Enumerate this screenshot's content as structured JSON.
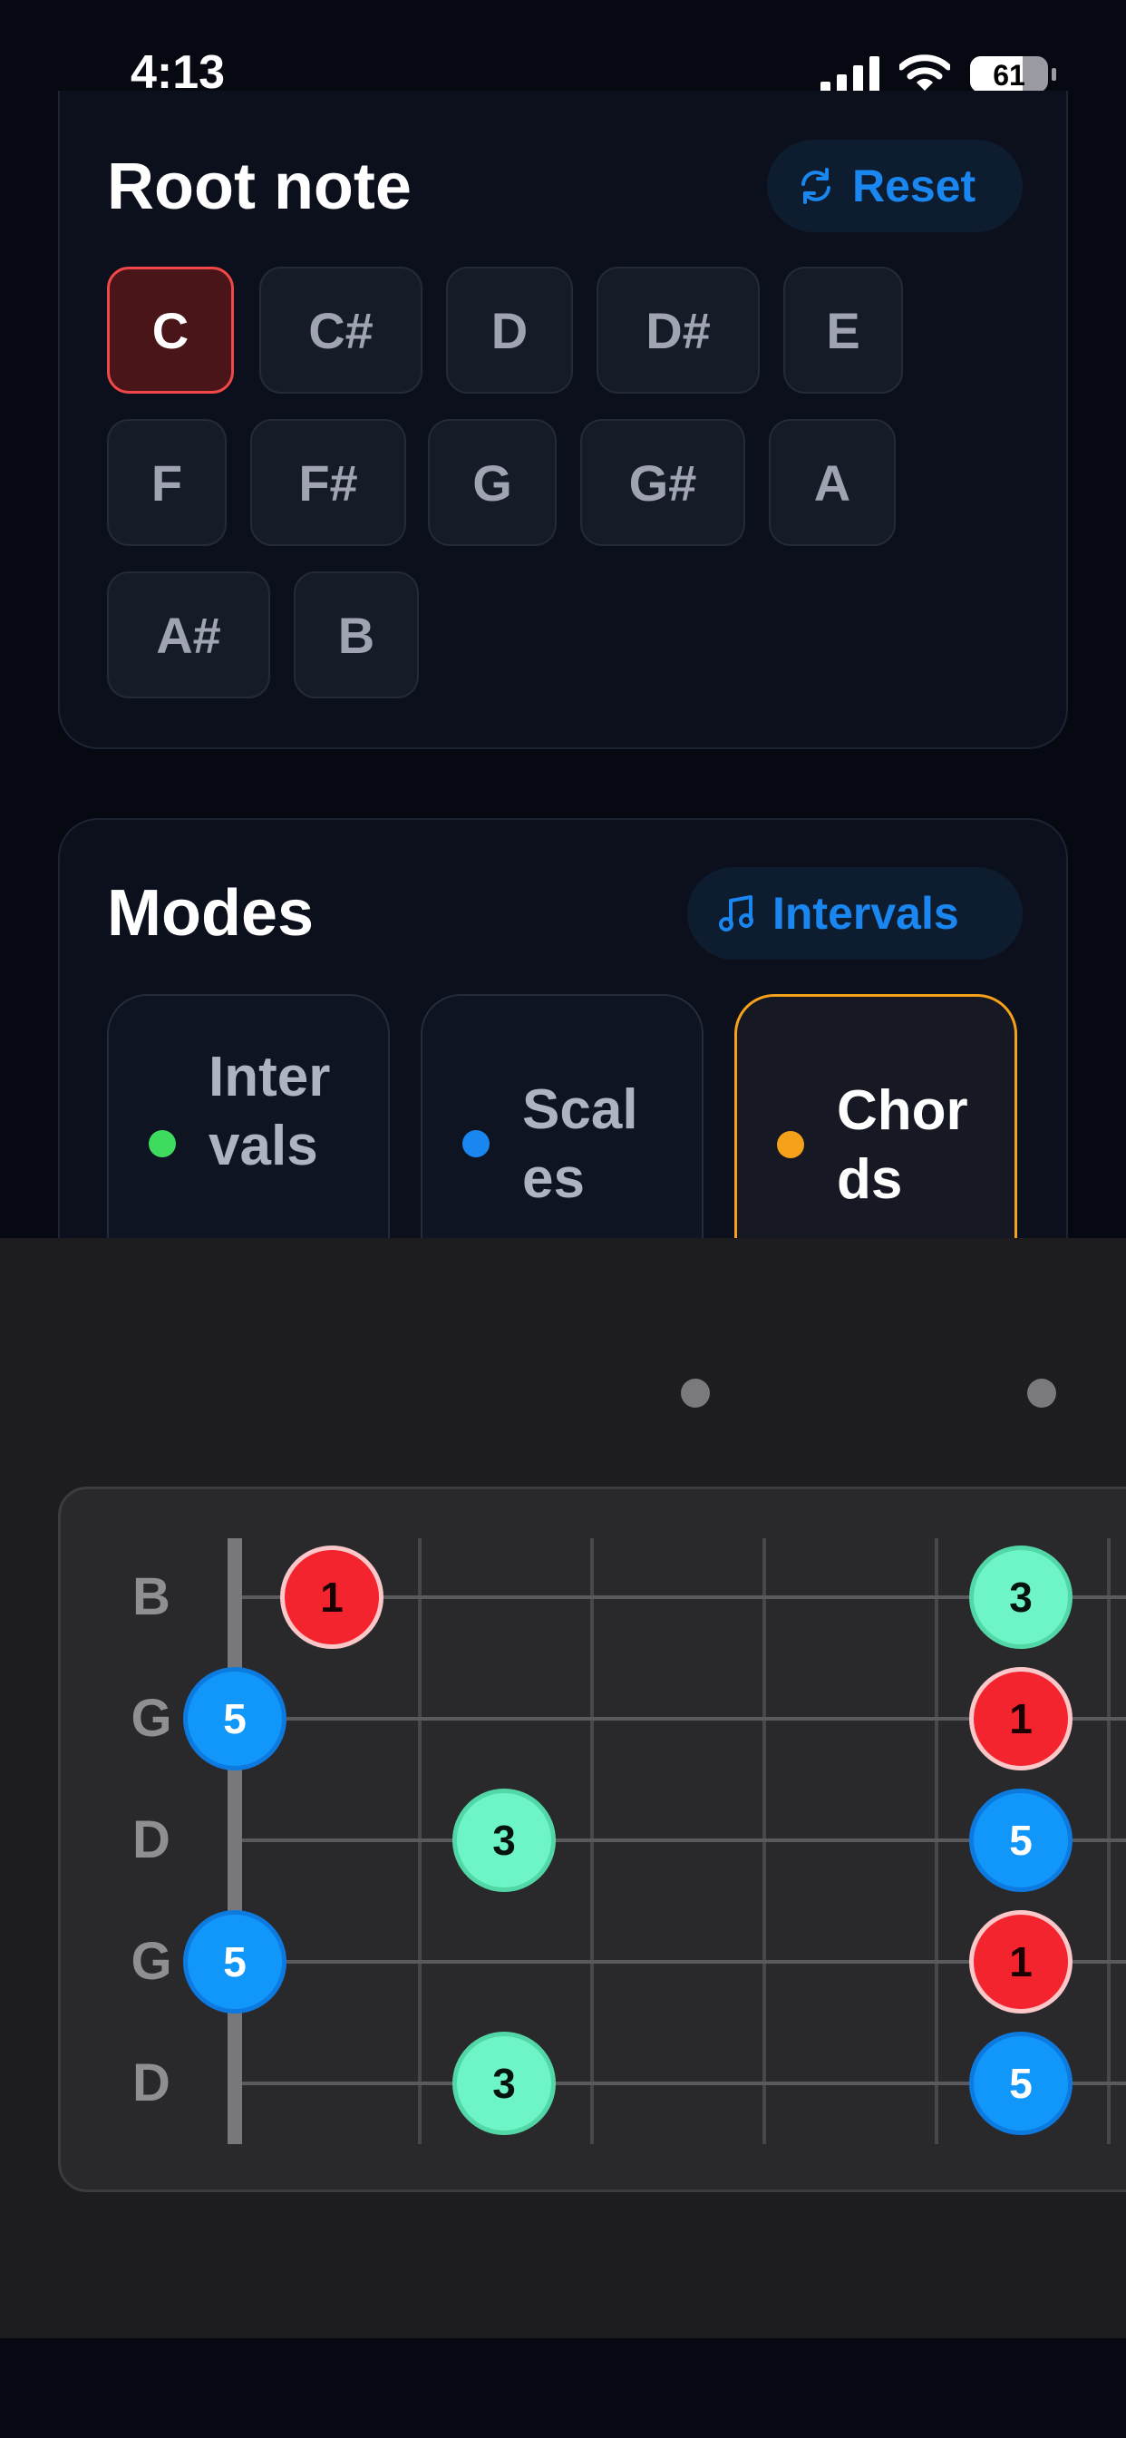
{
  "status_bar": {
    "time": "4:13",
    "battery": "61"
  },
  "root_note": {
    "title": "Root note",
    "reset_label": "Reset",
    "notes": [
      "C",
      "C#",
      "D",
      "D#",
      "E",
      "F",
      "F#",
      "G",
      "G#",
      "A",
      "A#",
      "B"
    ],
    "selected": "C"
  },
  "modes": {
    "title": "Modes",
    "intervals_button_label": "Intervals",
    "items": [
      {
        "label": "Intervals",
        "color": "#3ddc5f"
      },
      {
        "label": "Scales",
        "color": "#1a86f0"
      },
      {
        "label": "Chords",
        "color": "#f5a21a"
      }
    ],
    "selected": "Chords"
  },
  "fretboard": {
    "strings": [
      "B",
      "G",
      "D",
      "G",
      "D"
    ],
    "markers": [
      {
        "string": 0,
        "fret": 1,
        "label": "1"
      },
      {
        "string": 0,
        "fret": 5,
        "label": "3"
      },
      {
        "string": 1,
        "fret": 0,
        "label": "5"
      },
      {
        "string": 1,
        "fret": 5,
        "label": "1"
      },
      {
        "string": 2,
        "fret": 2,
        "label": "3"
      },
      {
        "string": 2,
        "fret": 5,
        "label": "5"
      },
      {
        "string": 3,
        "fret": 0,
        "label": "5"
      },
      {
        "string": 3,
        "fret": 5,
        "label": "1"
      },
      {
        "string": 4,
        "fret": 2,
        "label": "3"
      },
      {
        "string": 4,
        "fret": 5,
        "label": "5"
      }
    ]
  },
  "colors": {
    "root": "#f3242e",
    "third": "#6df5c8",
    "fifth": "#1197fa",
    "accent": "#1a86f0"
  }
}
